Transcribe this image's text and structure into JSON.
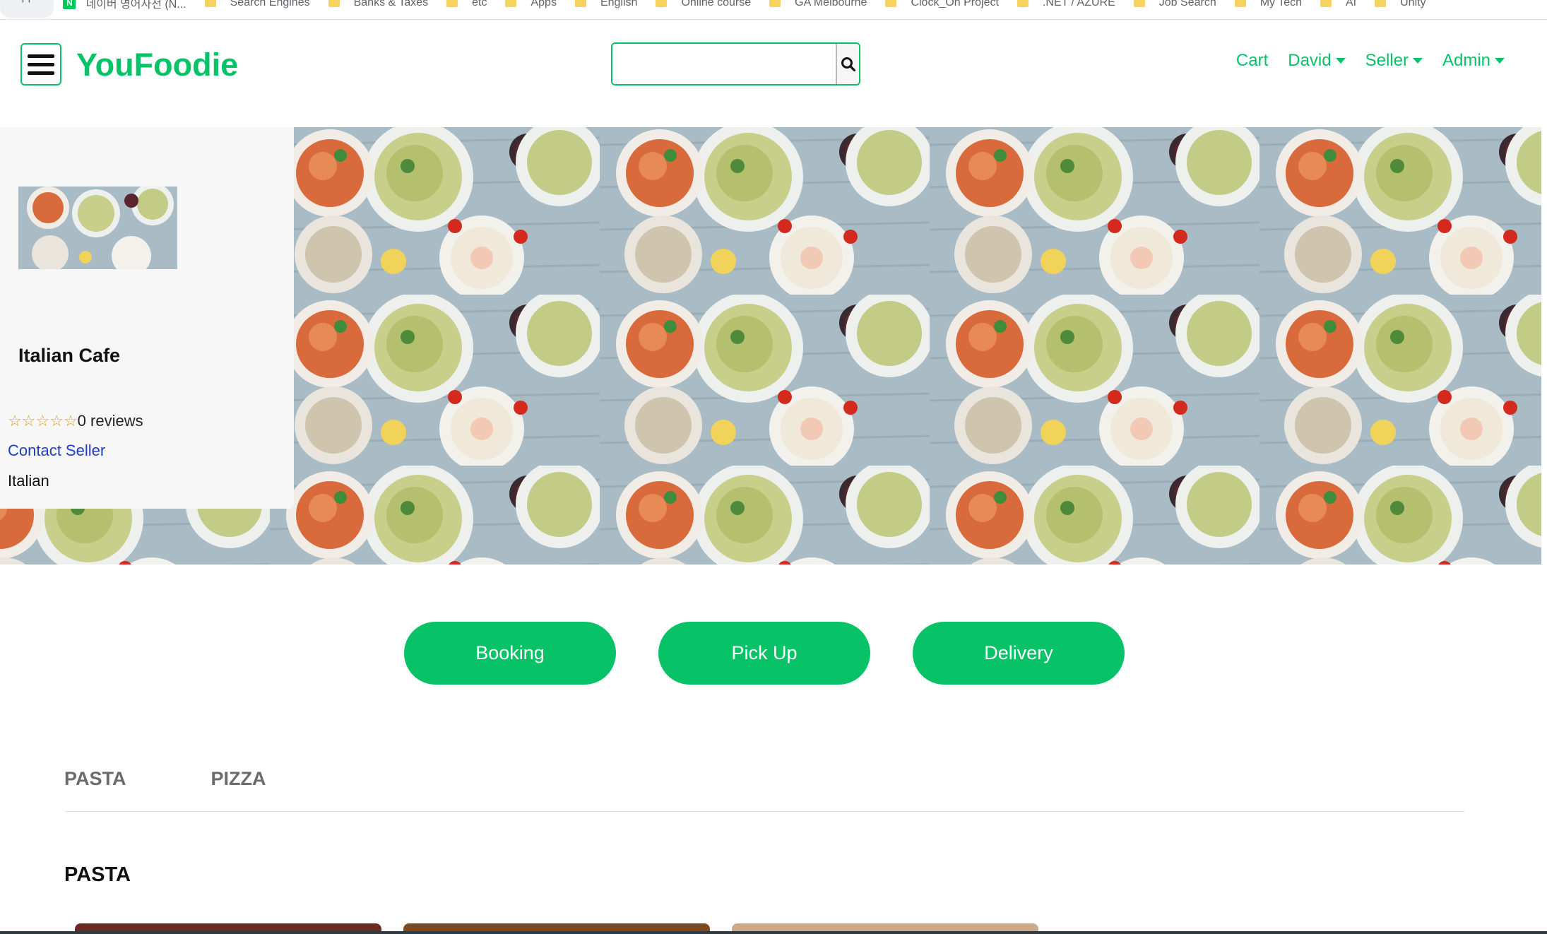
{
  "bookmarks": [
    {
      "label": "Apps",
      "icon": "apps-icon"
    },
    {
      "label": "네이버 영어사전 (N...",
      "icon": "naver-icon"
    },
    {
      "label": "Search Engines",
      "icon": "folder-icon"
    },
    {
      "label": "Banks & Taxes",
      "icon": "folder-icon"
    },
    {
      "label": "etc",
      "icon": "folder-icon"
    },
    {
      "label": "Apps",
      "icon": "folder-icon"
    },
    {
      "label": "English",
      "icon": "folder-icon"
    },
    {
      "label": "Online course",
      "icon": "folder-icon"
    },
    {
      "label": "GA Melbourne",
      "icon": "folder-icon"
    },
    {
      "label": "Clock_On Project",
      "icon": "folder-icon"
    },
    {
      "label": ".NET / AZURE",
      "icon": "folder-icon"
    },
    {
      "label": "Job Search",
      "icon": "folder-icon"
    },
    {
      "label": "My Tech",
      "icon": "folder-icon"
    },
    {
      "label": "AI",
      "icon": "folder-icon"
    },
    {
      "label": "Unity",
      "icon": "folder-icon"
    }
  ],
  "header": {
    "logo": "YouFoodie",
    "search": {
      "value": "",
      "placeholder": ""
    },
    "nav": {
      "cart": "Cart",
      "user": "David",
      "seller": "Seller",
      "admin": "Admin"
    }
  },
  "restaurant": {
    "name": "Italian Cafe",
    "rating_stars": 0,
    "reviews": "0 reviews",
    "contact": "Contact Seller",
    "cuisine": "Italian"
  },
  "order_options": [
    "Booking",
    "Pick Up",
    "Delivery"
  ],
  "menu_tabs": [
    "PASTA",
    "PIZZA"
  ],
  "section_title": "PASTA",
  "colors": {
    "accent": "#08c268",
    "link": "#1f3fbf",
    "star": "#e0a02a"
  }
}
